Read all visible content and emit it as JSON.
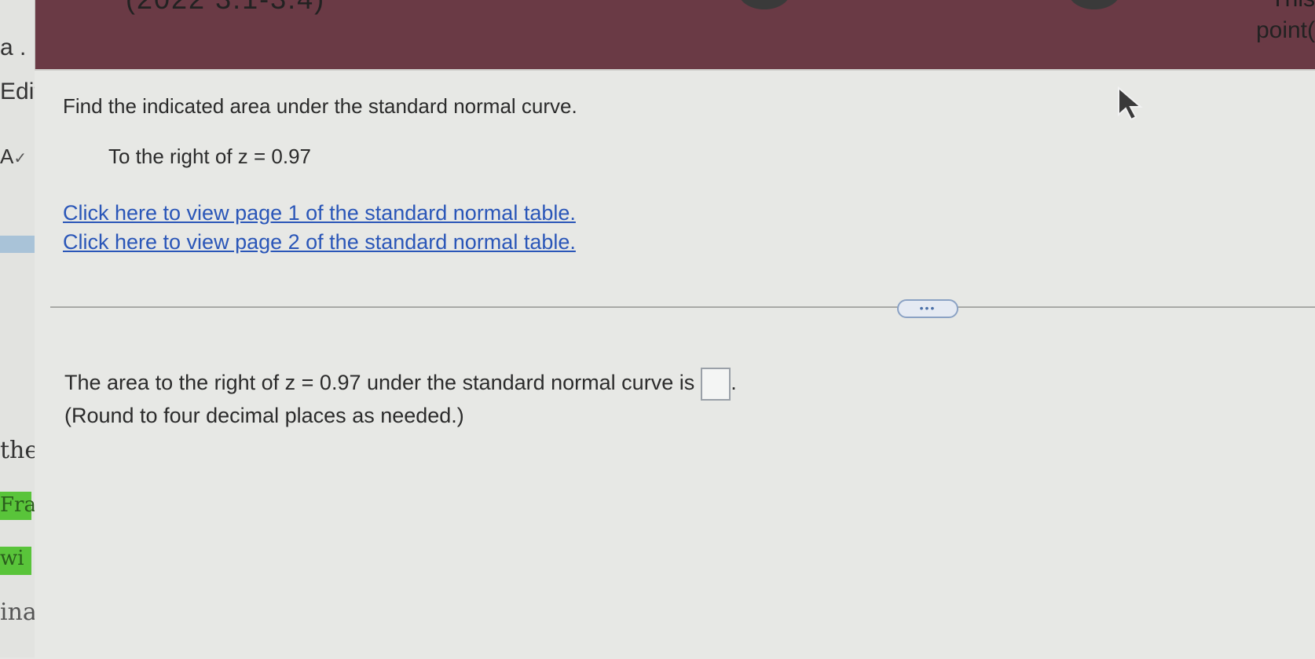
{
  "header": {
    "title": "(2022 3.1-3.4)",
    "right_cut_text": "This",
    "points_label": "point("
  },
  "left_strip": {
    "items": [
      "a .",
      "Edit",
      "A",
      "the",
      "Fra",
      "wi",
      "ina"
    ]
  },
  "question": {
    "prompt": "Find the indicated area under the standard normal curve.",
    "condition": "To the right of z = 0.97",
    "links": [
      "Click here to view page 1 of the standard normal table.",
      "Click here to view page 2 of the standard normal table."
    ],
    "expand_label": "•••",
    "answer_prefix": "The area to the right of z = 0.97 under the standard normal curve is",
    "answer_suffix": ".",
    "answer_value": "",
    "round_note": "(Round to four decimal places as needed.)"
  },
  "colors": {
    "header": "#6a3a45",
    "link": "#2a56b8",
    "green": "#59c43a"
  }
}
